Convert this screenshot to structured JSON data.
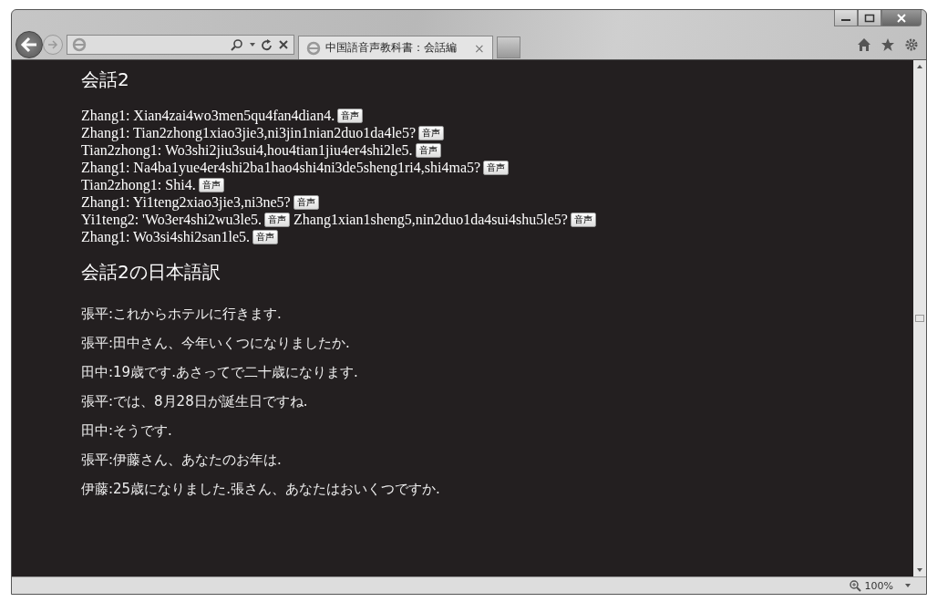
{
  "tab": {
    "title": "中国語音声教科書：会話編",
    "close": "×",
    "selected": true
  },
  "heading": "会話2",
  "dialogue": [
    {
      "segments": [
        {
          "text": "Zhang1: Xian4zai4wo3men5qu4fan4dian4.",
          "button": "音声"
        }
      ]
    },
    {
      "segments": [
        {
          "text": "Zhang1: Tian2zhong1xiao3jie3,ni3jin1nian2duo1da4le5?",
          "button": "音声"
        }
      ]
    },
    {
      "segments": [
        {
          "text": "Tian2zhong1: Wo3shi2jiu3sui4,hou4tian1jiu4er4shi2le5.",
          "button": "音声"
        }
      ]
    },
    {
      "segments": [
        {
          "text": "Zhang1: Na4ba1yue4er4shi2ba1hao4shi4ni3de5sheng1ri4,shi4ma5?",
          "button": "音声"
        }
      ]
    },
    {
      "segments": [
        {
          "text": "Tian2zhong1: Shi4.",
          "button": "音声"
        }
      ]
    },
    {
      "segments": [
        {
          "text": "Zhang1: Yi1teng2xiao3jie3,ni3ne5?",
          "button": "音声"
        }
      ]
    },
    {
      "segments": [
        {
          "text": "Yi1teng2: 'Wo3er4shi2wu3le5.",
          "button": "音声"
        },
        {
          "text": "Zhang1xian1sheng5,nin2duo1da4sui4shu5le5?",
          "button": "音声"
        }
      ]
    },
    {
      "segments": [
        {
          "text": "Zhang1: Wo3si4shi2san1le5.",
          "button": "音声"
        }
      ]
    }
  ],
  "translation_heading": "会話2の日本語訳",
  "translation": [
    "張平:これからホテルに行きます.",
    "張平:田中さん、今年いくつになりましたか.",
    "田中:19歳です.あさってで二十歳になります.",
    "張平:では、8月28日が誕生日ですね.",
    "田中:そうです.",
    "張平:伊藤さん、あなたのお年は.",
    "伊藤:25歳になりました.張さん、あなたはおいくつですか."
  ],
  "status_bar": {
    "zoom": "100%"
  }
}
